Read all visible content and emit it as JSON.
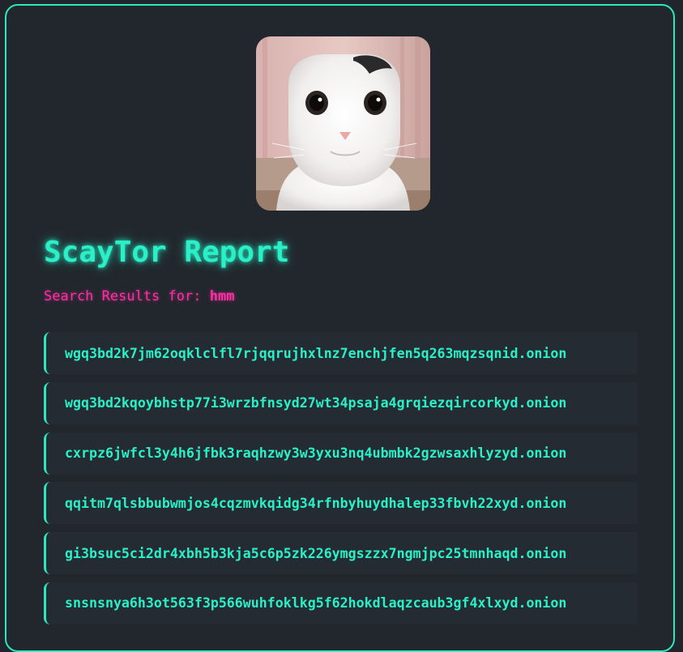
{
  "report": {
    "title": "ScayTor Report",
    "subtitle_prefix": "Search Results for:",
    "query": "hmm"
  },
  "results": [
    "wgq3bd2k7jm62oqklclfl7rjqqrujhxlnz7enchjfen5q263mqzsqnid.onion",
    "wgq3bd2kqoybhstp77i3wrzbfnsyd27wt34psaja4grqiezqircorkyd.onion",
    "cxrpz6jwfcl3y4h6jfbk3raqhzwy3w3yxu3nq4ubmbk2gzwsaxhlyzyd.onion",
    "qqitm7qlsbbubwmjos4cqzmvkqidg34rfnbyhuydhalep33fbvh22xyd.onion",
    "gi3bsuc5ci2dr4xbh5b3kja5c6p5zk226ymgszzx7ngmjpc25tmnhaqd.onion",
    "snsnsnya6h3ot563f3p566wuhfoklkg5f62hokdlaqzcaub3gf4xlxyd.onion"
  ],
  "colors": {
    "accent": "#2af0c8",
    "highlight": "#ff2fa3",
    "background": "#22272e"
  }
}
